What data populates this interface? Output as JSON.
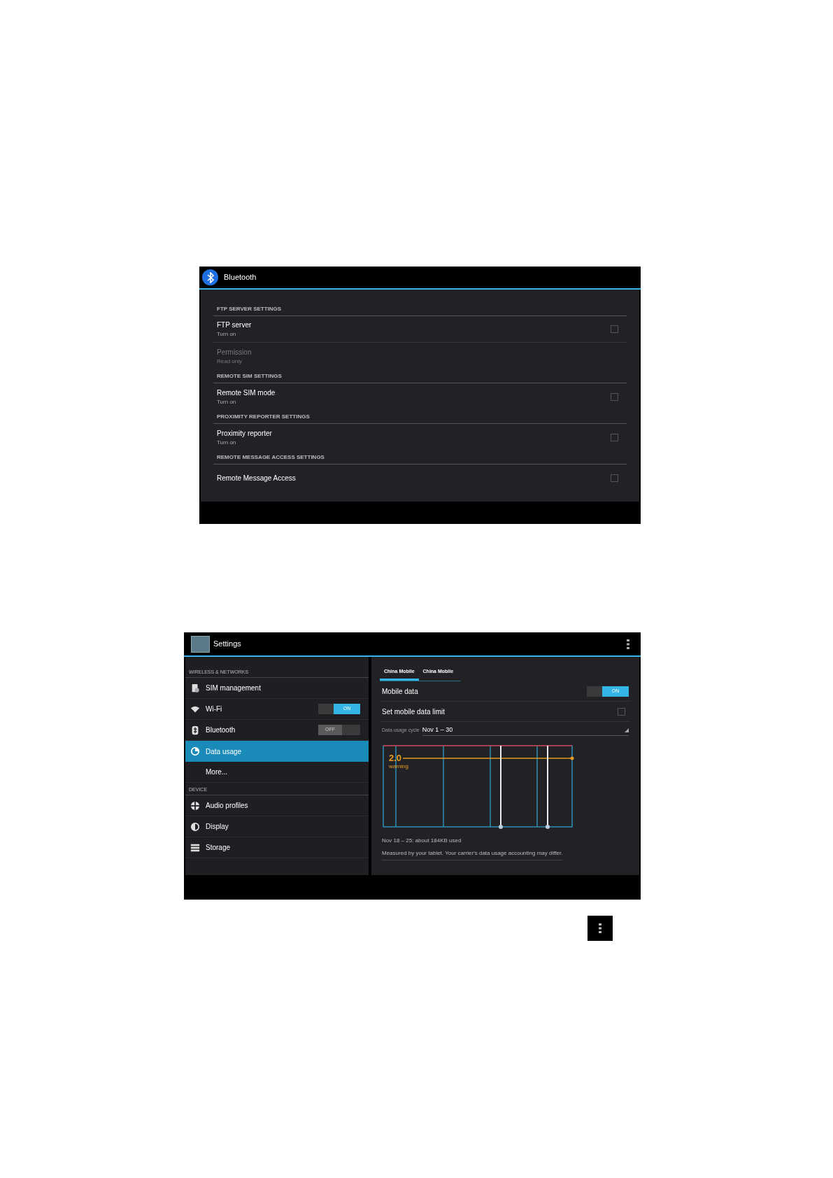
{
  "bluetooth_screen": {
    "title": "Bluetooth",
    "sections": [
      {
        "header": "FTP SERVER SETTINGS",
        "items": [
          {
            "kind": "checkbox",
            "title": "FTP server",
            "subtitle": "Turn on",
            "checked": false,
            "disabled": false
          },
          {
            "kind": "info",
            "title": "Permission",
            "subtitle": "Read only",
            "disabled": true
          }
        ]
      },
      {
        "header": "REMOTE SIM SETTINGS",
        "items": [
          {
            "kind": "checkbox",
            "title": "Remote SIM mode",
            "subtitle": "Turn on",
            "checked": false,
            "disabled": false
          }
        ]
      },
      {
        "header": "PROXIMITY REPORTER SETTINGS",
        "items": [
          {
            "kind": "checkbox",
            "title": "Proximity reporter",
            "subtitle": "Turn on",
            "checked": false,
            "disabled": false
          }
        ]
      },
      {
        "header": "REMOTE MESSAGE ACCESS SETTINGS",
        "items": [
          {
            "kind": "checkbox",
            "title": "Remote Message Access",
            "checked": false,
            "disabled": false
          }
        ]
      }
    ]
  },
  "settings_screen": {
    "title": "Settings",
    "sidebar": [
      {
        "header": "WIRELESS & NETWORKS",
        "items": [
          {
            "kind": "sim",
            "label": "SIM management",
            "selected": false
          },
          {
            "kind": "wifi",
            "label": "Wi-Fi",
            "selected": false,
            "toggle": {
              "on": true,
              "label": "ON"
            }
          },
          {
            "kind": "bluetooth",
            "label": "Bluetooth",
            "selected": false,
            "toggle": {
              "on": false,
              "label": "OFF"
            }
          },
          {
            "kind": "data",
            "label": "Data usage",
            "selected": true
          },
          {
            "kind": "plain",
            "label": "More...",
            "selected": false
          }
        ]
      },
      {
        "header": "DEVICE",
        "items": [
          {
            "kind": "audio",
            "label": "Audio profiles",
            "selected": false
          },
          {
            "kind": "display",
            "label": "Display",
            "selected": false
          },
          {
            "kind": "storage",
            "label": "Storage",
            "selected": false
          }
        ]
      }
    ],
    "detail": {
      "tabs": [
        {
          "label": "China Mobile",
          "selected": true
        },
        {
          "label": "China Mobile",
          "selected": false
        }
      ],
      "mobile_data": {
        "label": "Mobile data",
        "toggle": {
          "on": true,
          "label": "ON"
        }
      },
      "data_limit": {
        "label": "Set mobile data limit",
        "checked": false
      },
      "cycle": {
        "label": "Data usage cycle",
        "value": "Nov 1 – 30"
      },
      "chart": {
        "warning_value": "2.0",
        "warning_label": "warning"
      },
      "usage": "Nov 18 – 25: about 184KB used",
      "note": "Measured by your tablet. Your carrier's data usage accounting may differ."
    }
  }
}
